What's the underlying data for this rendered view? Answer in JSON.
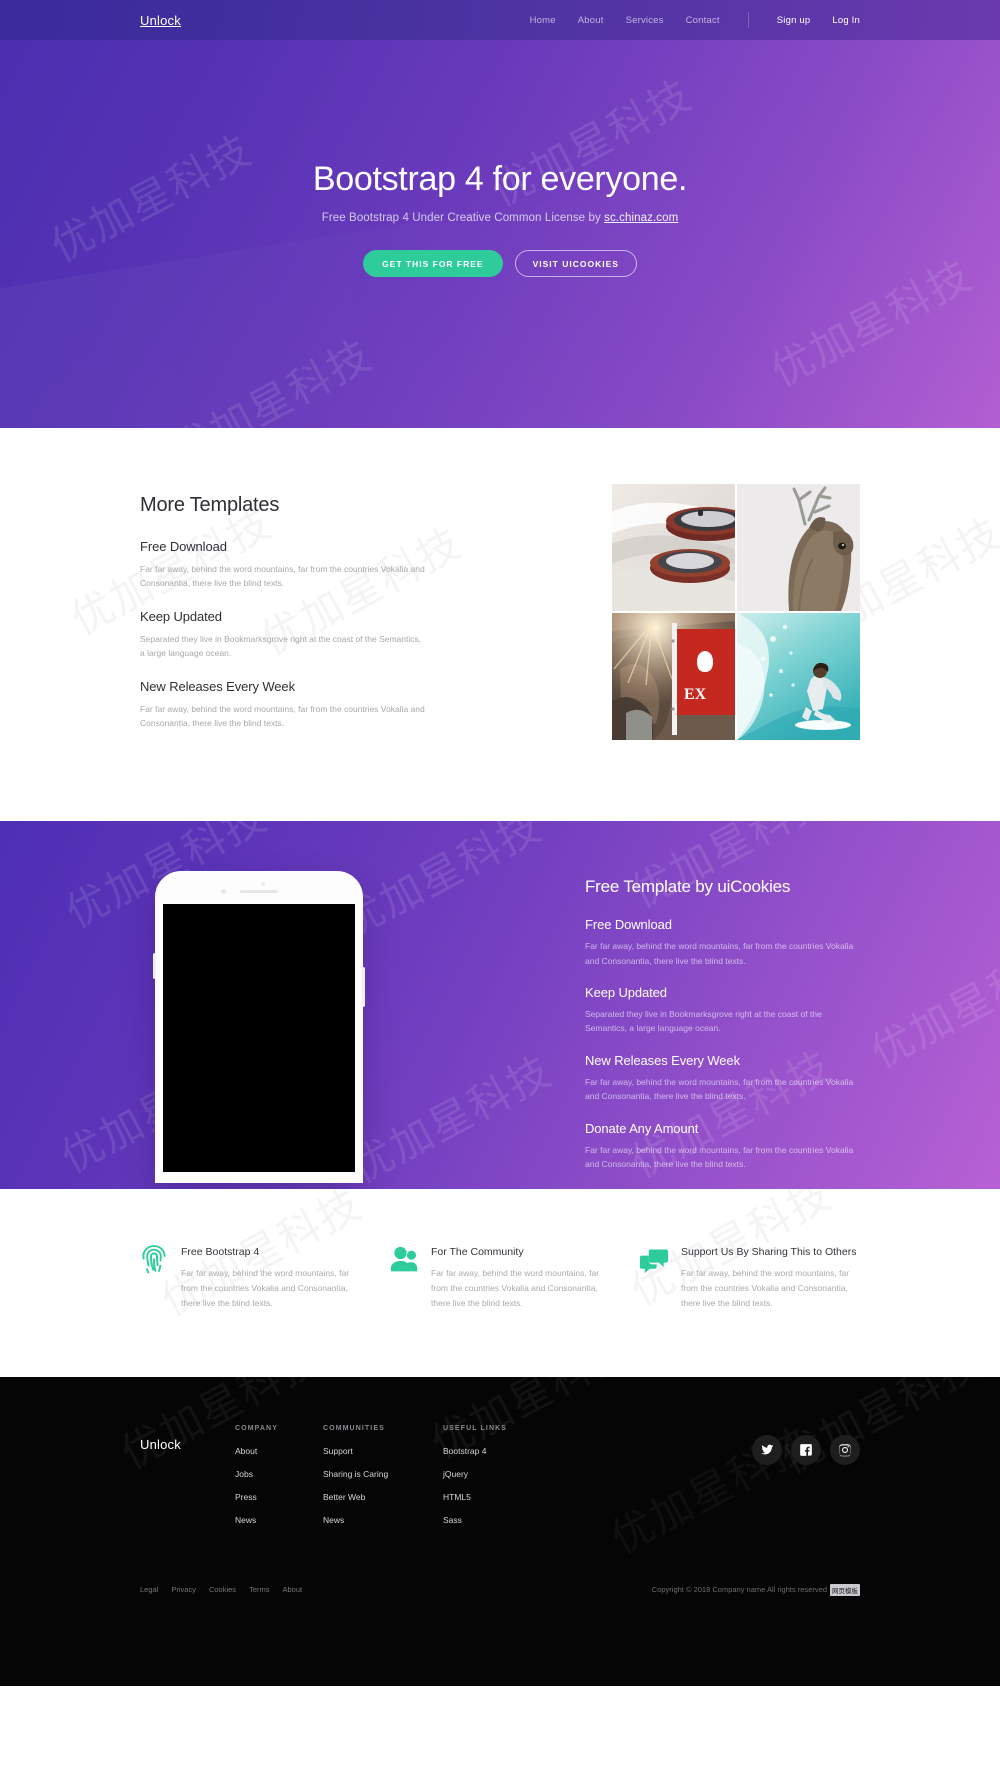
{
  "navbar": {
    "brand": "Unlock",
    "links": [
      {
        "label": "Home"
      },
      {
        "label": "About"
      },
      {
        "label": "Services"
      },
      {
        "label": "Contact"
      }
    ],
    "signup": "Sign up",
    "login": "Log In"
  },
  "hero": {
    "title": "Bootstrap 4 for everyone.",
    "subtitle_prefix": "Free Bootstrap 4 Under Creative Common License by ",
    "subtitle_link": "sc.chinaz.com",
    "primary_button": "GET THIS FOR FREE",
    "secondary_button": "VISIT UICOOKIES",
    "accent_color": "#2ecc9b"
  },
  "templates": {
    "title": "More Templates",
    "features": [
      {
        "title": "Free Download",
        "text": "Far far away, behind the word mountains, far from the countries Vokalia and Consonantia, there live the blind texts."
      },
      {
        "title": "Keep Updated",
        "text": "Separated they live in Bookmarksgrove right at the coast of the Semantics, a large language ocean."
      },
      {
        "title": "New Releases Every Week",
        "text": "Far far away, behind the word mountains, far from the countries Vokalia and Consonantia, there live the blind texts."
      }
    ],
    "gallery": [
      {
        "name": "spiral-staircase-photo"
      },
      {
        "name": "deer-antlers-photo"
      },
      {
        "name": "canyon-red-flag-photo"
      },
      {
        "name": "surfer-wave-photo"
      }
    ]
  },
  "phone_section": {
    "title": "Free Template by uiCookies",
    "items": [
      {
        "title": "Free Download",
        "text": "Far far away, behind the word mountains, far from the countries Vokalia and Consonantia, there live the blind texts."
      },
      {
        "title": "Keep Updated",
        "text": "Separated they live in Bookmarksgrove right at the coast of the Semantics, a large language ocean."
      },
      {
        "title": "New Releases Every Week",
        "text": "Far far away, behind the word mountains, far from the countries Vokalia and Consonantia, there live the blind texts."
      },
      {
        "title": "Donate Any Amount",
        "text": "Far far away, behind the word mountains, far from the countries Vokalia and Consonantia, there live the blind texts."
      }
    ]
  },
  "services": {
    "accent_color": "#2ecc9b",
    "items": [
      {
        "icon": "fingerprint-icon",
        "title": "Free Bootstrap 4",
        "text": "Far far away, behind the word mountains, far from the countries Vokalia and Consonantia, there live the blind texts."
      },
      {
        "icon": "users-icon",
        "title": "For The Community",
        "text": "Far far away, behind the word mountains, far from the countries Vokalia and Consonantia, there live the blind texts."
      },
      {
        "icon": "chat-bubbles-icon",
        "title": "Support Us By Sharing This to Others",
        "text": "Far far away, behind the word mountains, far from the countries Vokalia and Consonantia, there live the blind texts."
      }
    ]
  },
  "footer": {
    "brand": "Unlock",
    "columns": [
      {
        "heading": "COMPANY",
        "links": [
          "About",
          "Jobs",
          "Press",
          "News"
        ]
      },
      {
        "heading": "COMMUNITIES",
        "links": [
          "Support",
          "Sharing is Caring",
          "Better Web",
          "News"
        ]
      },
      {
        "heading": "USEFUL LINKS",
        "links": [
          "Bootstrap 4",
          "jQuery",
          "HTML5",
          "Sass"
        ]
      }
    ],
    "socials": [
      {
        "icon": "twitter-icon"
      },
      {
        "icon": "facebook-icon"
      },
      {
        "icon": "instagram-icon"
      }
    ],
    "legal": [
      "Legal",
      "Privacy",
      "Cookies",
      "Terms",
      "About"
    ],
    "copyright": "Copyright © 2018 Company name All rights reserved",
    "copyright_badge": "网页模板"
  },
  "watermark": {
    "text": "优加星科技"
  }
}
